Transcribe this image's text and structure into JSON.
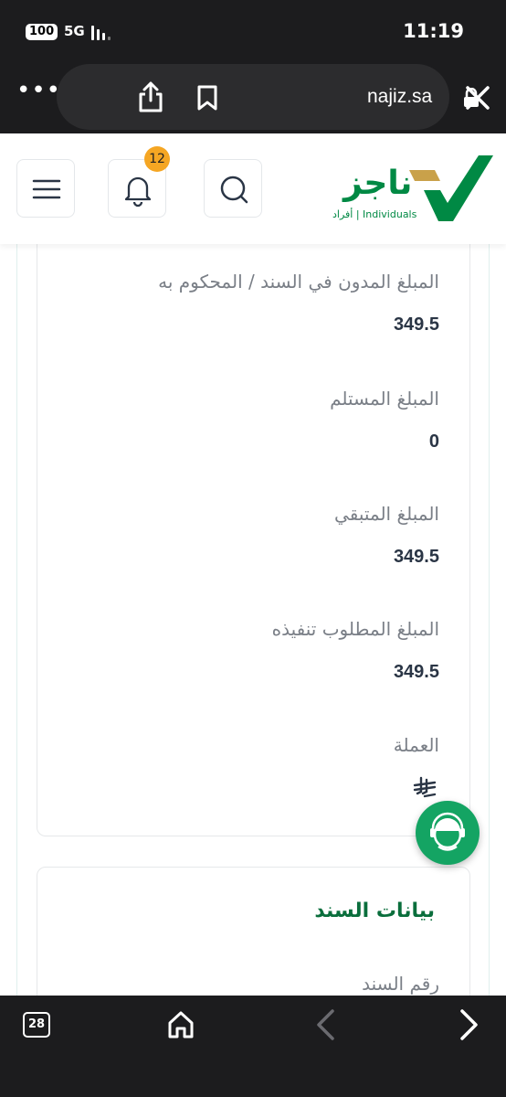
{
  "status_bar": {
    "battery": "100",
    "network": "5G",
    "time": "11:19"
  },
  "browser": {
    "url": "najiz.sa"
  },
  "header": {
    "notification_count": "12",
    "logo_name": "ناجز",
    "logo_subtitle": "أفراد | Individuals"
  },
  "fields": [
    {
      "label": "المبلغ المدون في السند / المحكوم به",
      "value": "349.5"
    },
    {
      "label": "المبلغ المستلم",
      "value": "0"
    },
    {
      "label": "المبلغ المتبقي",
      "value": "349.5"
    },
    {
      "label": "المبلغ المطلوب تنفيذه",
      "value": "349.5"
    },
    {
      "label": "العملة"
    }
  ],
  "bond_section": {
    "title": "بيانات السند",
    "first_label": "رقم السند"
  },
  "toolbar": {
    "tab_count": "28"
  },
  "colors": {
    "brand_green": "#008944",
    "accent_gold": "#c9a14a",
    "fab_green": "#14a463",
    "badge": "#f5a623"
  }
}
